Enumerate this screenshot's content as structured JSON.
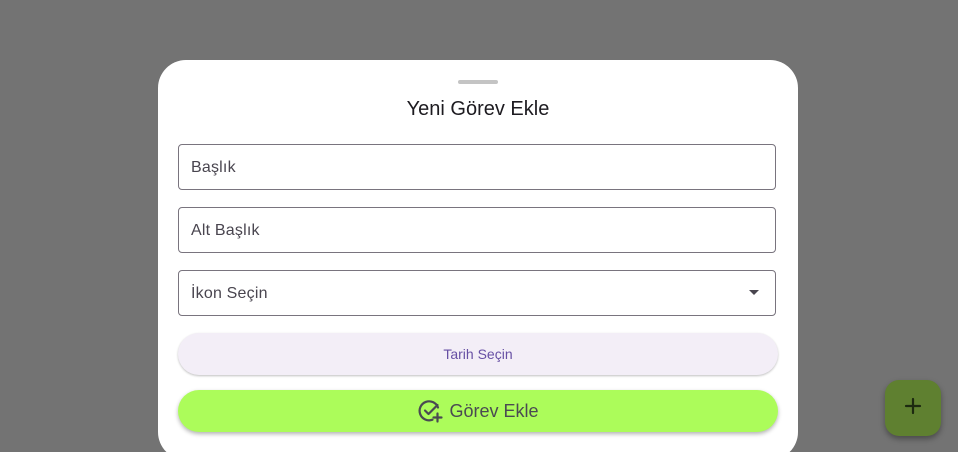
{
  "dialog": {
    "title": "Yeni Görev Ekle",
    "fields": {
      "title_label": "Başlık",
      "subtitle_label": "Alt Başlık",
      "icon_select_label": "İkon Seçin"
    },
    "date_button_label": "Tarih Seçin",
    "submit_button_label": "Görev Ekle"
  },
  "icons": {
    "dropdown": "arrow-drop-down-icon",
    "submit": "task-add-icon",
    "fab": "plus-icon"
  },
  "colors": {
    "scrim": "#737373",
    "sheet": "#ffffff",
    "date_button_bg": "#f3eef7",
    "date_button_text": "#6750a4",
    "submit_button_bg": "#acfc5a",
    "fab_bg": "#5f8030"
  }
}
